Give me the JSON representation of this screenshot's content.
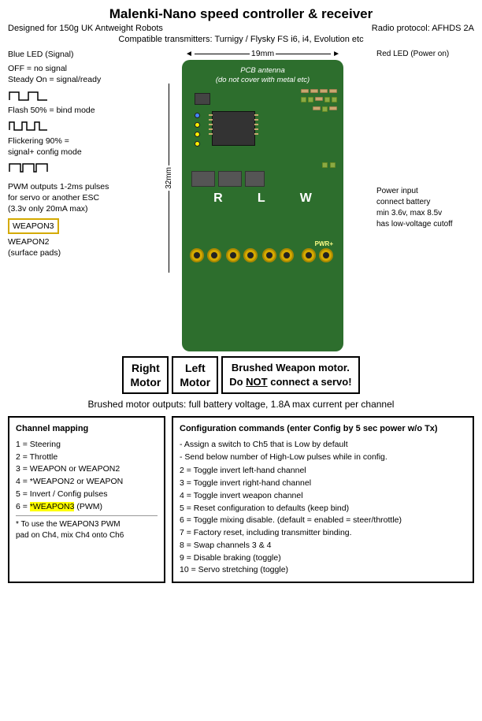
{
  "header": {
    "title": "Malenki-Nano speed controller & receiver",
    "sub_left": "Designed for 150g UK Antweight Robots",
    "sub_right": "Radio protocol: AFHDS 2A",
    "compatible": "Compatible transmitters: Turnigy / Flysky FS i6, i4, Evolution etc"
  },
  "dimensions": {
    "width_label": "19mm",
    "height_label": "32mm"
  },
  "pcb": {
    "antenna_label": "PCB antenna\n(do not cover with metal etc)",
    "led_red_label": "Red LED (Power on)",
    "led_blue_label": "Blue LED (Signal)",
    "motor_r_label": "R",
    "motor_l_label": "L",
    "motor_w_label": "W",
    "pwr_label": "PWR+",
    "power_input_note": "Power input\nconnect battery\nmin 3.6v, max 8.5v\nhas low-voltage cutoff"
  },
  "signal_states": {
    "off": "OFF = no signal",
    "steady": "Steady On = signal/ready",
    "flash50": "Flash 50% = bind mode",
    "flicker90": "Flickering 90% =\nsignal+ config mode"
  },
  "pwm_note": {
    "line1": "PWM outputs 1-2ms pulses",
    "line2": "for servo or another ESC",
    "line3": "(3.3v only 20mA max)",
    "weapon3_label": "WEAPON3",
    "weapon2_label": "WEAPON2",
    "weapon2_sub": "(surface pads)"
  },
  "motor_labels": {
    "right_motor": "Right\nMotor",
    "left_motor": "Left\nMotor",
    "weapon_label": "Brushed Weapon motor.",
    "weapon_note": "Do NOT connect a servo!"
  },
  "brushed_note": "Brushed motor outputs: full battery voltage, 1.8A max current per channel",
  "channel_mapping": {
    "title": "Channel mapping",
    "items": [
      "1 = Steering",
      "2 = Throttle",
      "3 = WEAPON or WEAPON2",
      "4 = *WEAPON2 or WEAPON",
      "5 = Invert / Config pulses",
      "6 = *WEAPON3 (PWM)"
    ],
    "footnote": "* To use the WEAPON3 PWM\npad on Ch4, mix Ch4 onto Ch6"
  },
  "config_commands": {
    "title": "Configuration commands (enter Config by 5 sec power w/o Tx)",
    "intro1": "- Assign a switch to Ch5 that is Low by default",
    "intro2": "- Send below number of High-Low pulses while in config.",
    "commands": [
      "2 = Toggle invert left-hand channel",
      "3 = Toggle invert right-hand channel",
      "4 = Toggle invert weapon channel",
      "5 = Reset configuration to defaults (keep bind)",
      "6 = Toggle mixing disable. (default = enabled = steer/throttle)",
      "7 = Factory reset, including transmitter binding.",
      "8 = Swap channels 3 & 4",
      "9 = Disable braking (toggle)",
      "10 = Servo stretching (toggle)"
    ]
  }
}
